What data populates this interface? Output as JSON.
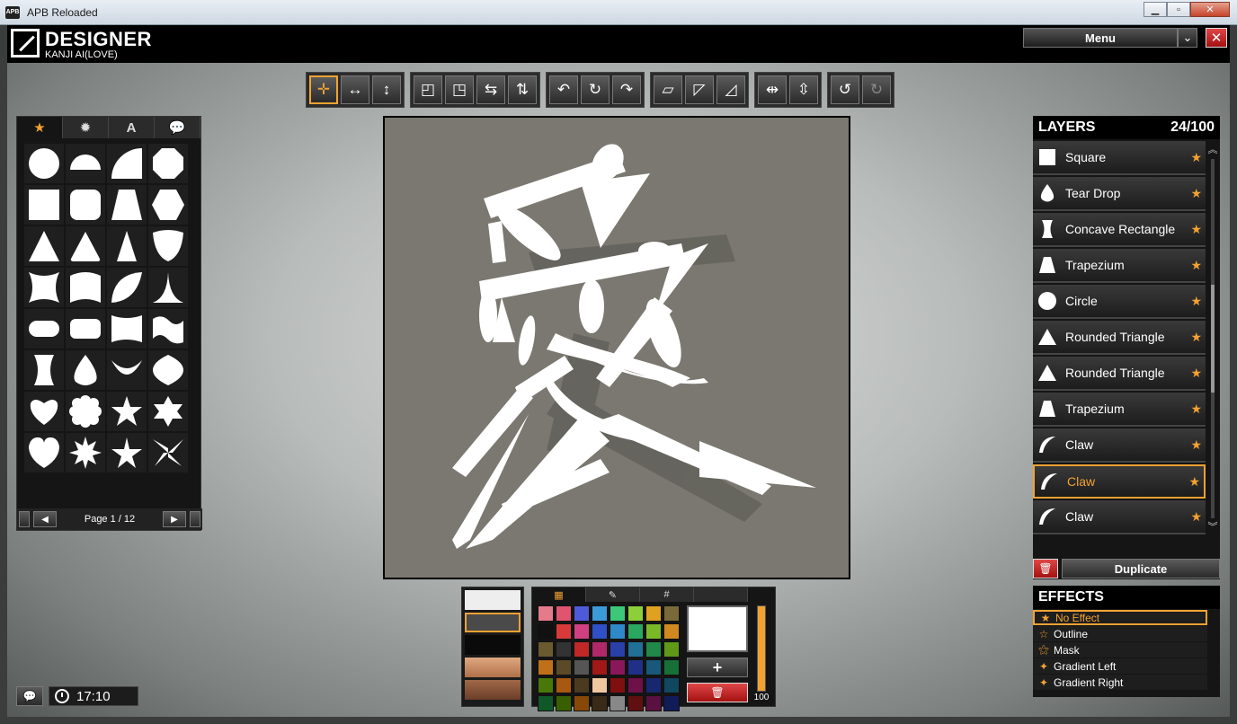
{
  "window": {
    "title": "APB Reloaded",
    "icon_text": "APB"
  },
  "header": {
    "title": "DESIGNER",
    "subtitle": "KANJI AI(LOVE)",
    "menu_label": "Menu",
    "drop_icon": "chevron-down-icon",
    "close_icon": "close-icon"
  },
  "toolbar": {
    "groups": [
      [
        "move-icon",
        "scale-horizontal-icon",
        "scale-vertical-icon"
      ],
      [
        "align-top-left-icon",
        "align-center-icon",
        "stretch-horizontal-icon",
        "stretch-vertical-icon"
      ],
      [
        "rotate-left-icon",
        "rotate-icon",
        "rotate-right-icon"
      ],
      [
        "skew-horizontal-icon",
        "skew-top-icon",
        "skew-vertical-icon"
      ],
      [
        "flip-horizontal-icon",
        "flip-vertical-icon"
      ],
      [
        "undo-icon",
        "redo-icon"
      ]
    ]
  },
  "shapes": {
    "tabs": [
      "★",
      "✹",
      "A",
      "💬"
    ],
    "active_tab": 0,
    "page_label": "Page 1 / 12"
  },
  "layers": {
    "title": "LAYERS",
    "count": "24/100",
    "items": [
      {
        "name": "Square",
        "shape": "square"
      },
      {
        "name": "Tear Drop",
        "shape": "teardrop"
      },
      {
        "name": "Concave Rectangle",
        "shape": "concave"
      },
      {
        "name": "Trapezium",
        "shape": "trapezium"
      },
      {
        "name": "Circle",
        "shape": "circle"
      },
      {
        "name": "Rounded Triangle",
        "shape": "triangle"
      },
      {
        "name": "Rounded Triangle",
        "shape": "triangle"
      },
      {
        "name": "Trapezium",
        "shape": "trapezium"
      },
      {
        "name": "Claw",
        "shape": "claw"
      },
      {
        "name": "Claw",
        "shape": "claw"
      },
      {
        "name": "Claw",
        "shape": "claw"
      }
    ],
    "selected_index": 9,
    "duplicate_label": "Duplicate"
  },
  "effects": {
    "title": "EFFECTS",
    "items": [
      "No Effect",
      "Outline",
      "Mask",
      "Gradient Left",
      "Gradient Right"
    ],
    "selected_index": 0
  },
  "colors": {
    "tabs": [
      "▦",
      "✎",
      "#",
      ""
    ],
    "palette": [
      "#e57a8a",
      "#e0546f",
      "#4e5bd8",
      "#3c9ad8",
      "#3cc878",
      "#8ccf38",
      "#e0a020",
      "#7a6a3a",
      "#111111",
      "#d83a3a",
      "#d04080",
      "#3050c8",
      "#2f88c8",
      "#2aa860",
      "#7ab828",
      "#d08820",
      "#6a5a30",
      "#333333",
      "#c02828",
      "#b02868",
      "#2840a8",
      "#207098",
      "#208848",
      "#609818",
      "#c07018",
      "#5a4a28",
      "#555555",
      "#a01818",
      "#8a1858",
      "#203088",
      "#185878",
      "#187038",
      "#487808",
      "#a85810",
      "#4a3a20",
      "#f0c8a0",
      "#801010",
      "#701048",
      "#182870",
      "#104860",
      "#105828",
      "#386000",
      "#884808",
      "#3a2a18",
      "#888888",
      "#601010",
      "#5a1040",
      "#101c58",
      "#0c3848",
      "#0c4820",
      "#284800",
      "#683808",
      "#2a1a10",
      "#ffffff"
    ],
    "opacity": 100,
    "opacity_label": "100"
  },
  "clock": {
    "time": "17:10"
  }
}
